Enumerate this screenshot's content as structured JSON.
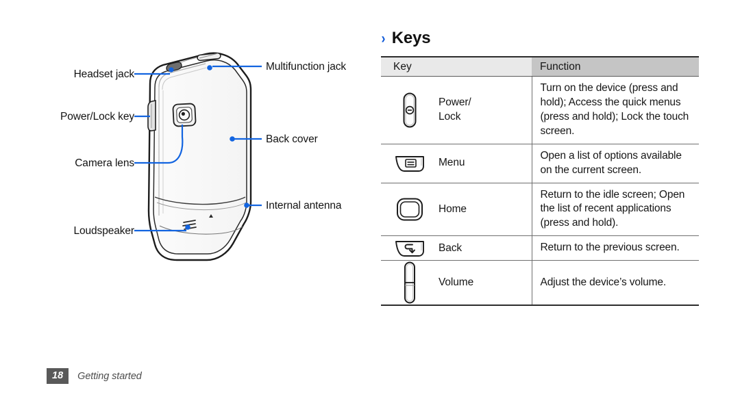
{
  "page": {
    "footer_page_number": "18",
    "footer_section": "Getting started"
  },
  "diagram": {
    "name": "device-back-view",
    "callouts": [
      {
        "label": "Headset jack",
        "side": "left"
      },
      {
        "label": "Power/Lock key",
        "side": "left"
      },
      {
        "label": "Camera lens",
        "side": "left"
      },
      {
        "label": "Loudspeaker",
        "side": "left"
      },
      {
        "label": "Multifunction jack",
        "side": "right"
      },
      {
        "label": "Back cover",
        "side": "right"
      },
      {
        "label": "Internal antenna",
        "side": "right"
      }
    ],
    "accent_color": "#1264e0"
  },
  "keys_section": {
    "chevron": "›",
    "heading": "Keys",
    "table": {
      "columns": [
        "Key",
        "Function"
      ],
      "rows": [
        {
          "icon": "power-key-icon",
          "key": "Power/\nLock",
          "key_line1": "Power/",
          "key_line2": "Lock",
          "function": "Turn on the device (press and hold); Access the quick menus (press and hold); Lock the touch screen."
        },
        {
          "icon": "menu-key-icon",
          "key": "Menu",
          "key_line1": "Menu",
          "key_line2": "",
          "function": "Open a list of options available on the current screen."
        },
        {
          "icon": "home-key-icon",
          "key": "Home",
          "key_line1": "Home",
          "key_line2": "",
          "function": "Return to the idle screen; Open the list of recent applications (press and hold)."
        },
        {
          "icon": "back-key-icon",
          "key": "Back",
          "key_line1": "Back",
          "key_line2": "",
          "function": "Return to the previous screen."
        },
        {
          "icon": "volume-key-icon",
          "key": "Volume",
          "key_line1": "Volume",
          "key_line2": "",
          "function": "Adjust the device’s volume."
        }
      ]
    }
  }
}
